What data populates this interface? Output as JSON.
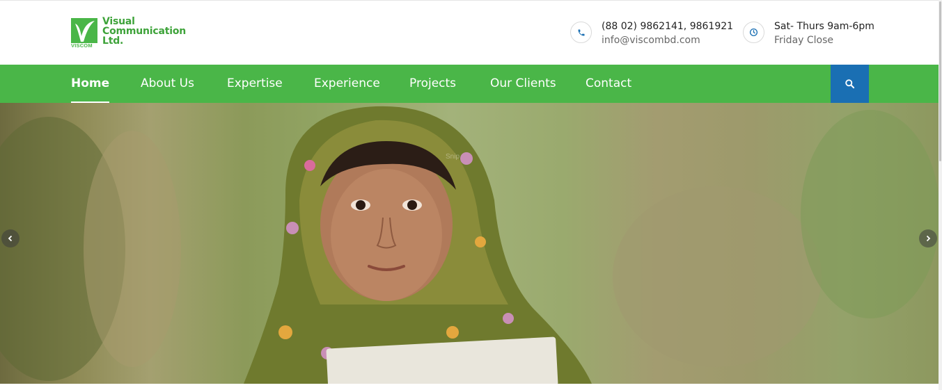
{
  "brand": {
    "name_line1": "Visual",
    "name_line2": "Communication",
    "name_line3": "Ltd.",
    "mark_text": "VISCOM",
    "color": "#4ab648"
  },
  "contact": {
    "phone": "(88 02) 9862141, 9861921",
    "email": "info@viscombd.com",
    "phone_icon": "phone-icon",
    "hours_main": "Sat- Thurs 9am-6pm",
    "hours_sub": "Friday Close",
    "hours_icon": "clock-icon"
  },
  "nav": {
    "background": "#4ab648",
    "items": [
      {
        "label": "Home",
        "active": true
      },
      {
        "label": "About Us"
      },
      {
        "label": "Expertise"
      },
      {
        "label": "Experience"
      },
      {
        "label": "Projects"
      },
      {
        "label": "Our Clients"
      },
      {
        "label": "Contact"
      }
    ],
    "search_icon": "search-icon",
    "search_color": "#1a6fb3"
  },
  "hero": {
    "prev_icon": "chevron-left-icon",
    "next_icon": "chevron-right-icon",
    "watermark": "Snip"
  }
}
